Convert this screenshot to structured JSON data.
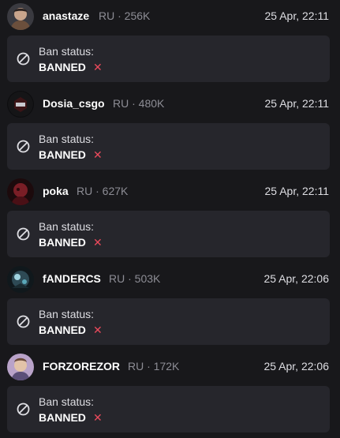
{
  "colors": {
    "background": "#18181b",
    "card": "#26262c",
    "ban_x": "#eb4a5c",
    "meta_text": "#8d8d95"
  },
  "entries": [
    {
      "username": "anastaze",
      "meta": "RU · 256K",
      "timestamp": "25 Apr, 22:11",
      "status_label": "Ban status:",
      "status_value": "BANNED",
      "status_icon": "x-mark",
      "avatar_icon": "avatar-photo"
    },
    {
      "username": "Dosia_csgo",
      "meta": "RU · 480K",
      "timestamp": "25 Apr, 22:11",
      "status_label": "Ban status:",
      "status_value": "BANNED",
      "status_icon": "x-mark",
      "avatar_icon": "avatar-photo"
    },
    {
      "username": "poka",
      "meta": "RU · 627K",
      "timestamp": "25 Apr, 22:11",
      "status_label": "Ban status:",
      "status_value": "BANNED",
      "status_icon": "x-mark",
      "avatar_icon": "avatar-photo"
    },
    {
      "username": "fANDERCS",
      "meta": "RU · 503K",
      "timestamp": "25 Apr, 22:06",
      "status_label": "Ban status:",
      "status_value": "BANNED",
      "status_icon": "x-mark",
      "avatar_icon": "avatar-photo"
    },
    {
      "username": "FORZOREZOR",
      "meta": "RU · 172K",
      "timestamp": "25 Apr, 22:06",
      "status_label": "Ban status:",
      "status_value": "BANNED",
      "status_icon": "x-mark",
      "avatar_icon": "avatar-photo"
    }
  ],
  "x_glyph": "✕"
}
